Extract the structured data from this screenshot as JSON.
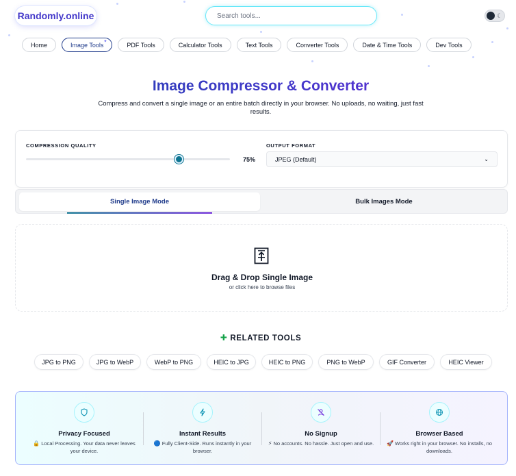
{
  "header": {
    "logo": "Randomly.online",
    "search_placeholder": "Search tools...",
    "theme_toggle_icon": "moon-icon"
  },
  "nav": [
    {
      "label": "Home",
      "active": false
    },
    {
      "label": "Image Tools",
      "active": true
    },
    {
      "label": "PDF Tools",
      "active": false
    },
    {
      "label": "Calculator Tools",
      "active": false
    },
    {
      "label": "Text Tools",
      "active": false
    },
    {
      "label": "Converter Tools",
      "active": false
    },
    {
      "label": "Date & Time Tools",
      "active": false
    },
    {
      "label": "Dev Tools",
      "active": false
    }
  ],
  "hero": {
    "title": "Image Compressor & Converter",
    "subtitle": "Compress and convert a single image or an entire batch directly in your browser. No uploads, no waiting, just fast results."
  },
  "settings": {
    "quality_label": "COMPRESSION QUALITY",
    "quality_percent": 75,
    "quality_display": "75%",
    "format_label": "OUTPUT FORMAT",
    "format_value": "JPEG (Default)"
  },
  "modes": {
    "single": "Single Image Mode",
    "bulk": "Bulk Images Mode",
    "active": "single"
  },
  "dropzone": {
    "icon": "upload-file-icon",
    "title": "Drag & Drop Single Image",
    "subtitle": "or click here to browse files"
  },
  "related": {
    "title": "RELATED TOOLS",
    "title_icon": "puzzle-icon",
    "items": [
      "JPG to PNG",
      "JPG to WebP",
      "WebP to PNG",
      "HEIC to JPG",
      "HEIC to PNG",
      "PNG to WebP",
      "GIF Converter",
      "HEIC Viewer"
    ]
  },
  "features": [
    {
      "icon": "shield-icon",
      "title": "Privacy Focused",
      "badge": "🔒",
      "desc": "Local Processing. Your data never leaves your device."
    },
    {
      "icon": "lightning-icon",
      "title": "Instant Results",
      "badge": "🔵",
      "desc": "Fully Client-Side. Runs instantly in your browser."
    },
    {
      "icon": "user-slash-icon",
      "title": "No Signup",
      "badge": "⚡",
      "desc": "No accounts. No hassle. Just open and use."
    },
    {
      "icon": "globe-icon",
      "title": "Browser Based",
      "badge": "🚀",
      "desc": "Works right in your browser. No installs, no downloads."
    }
  ],
  "colors": {
    "accent": "#4338ca",
    "slider": "#0e7490",
    "feature_border": "#a5b4fc"
  }
}
